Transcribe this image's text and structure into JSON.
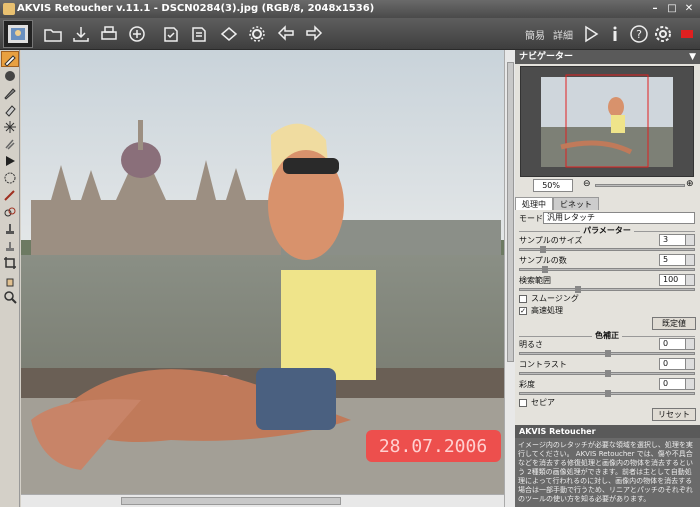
{
  "window": {
    "title": "AKVIS Retoucher v.11.1 - DSCN0284(3).jpg (RGB/8, 2048x1536)",
    "controls": [
      "minimize",
      "maximize",
      "close"
    ]
  },
  "toolbar": {
    "mode_simple": "簡易",
    "mode_detail": "詳細",
    "icons": [
      "open-icon",
      "save-icon",
      "print-icon",
      "share-icon",
      "batch-icon",
      "import-icon",
      "plugin-icon",
      "settings-gear-icon",
      "undo-arrow-icon",
      "redo-arrow-icon",
      "run-icon",
      "info-icon",
      "help-icon",
      "preferences-icon",
      "notify-icon"
    ]
  },
  "tools": [
    "retouch",
    "fill",
    "brush",
    "eraser",
    "magic",
    "clone",
    "run",
    "patch",
    "chameleon",
    "smart-tool",
    "stamp",
    "crop",
    "hand",
    "zoom"
  ],
  "navigator": {
    "title": "ナビゲーター",
    "zoom": "50%"
  },
  "tabs": {
    "active": "処理中",
    "other": "ビネット"
  },
  "processing": {
    "mode_label": "モード",
    "mode_value": "汎用レタッチ",
    "params_section": "パラメーター",
    "sample_size_label": "サンプルのサイズ",
    "sample_size_value": "3",
    "sample_count_label": "サンプルの数",
    "sample_count_value": "5",
    "search_range_label": "検索範囲",
    "search_range_value": "100",
    "smoothing_label": "スムージング",
    "smoothing_checked": false,
    "fast_label": "高速処理",
    "fast_checked": true,
    "default_button": "既定値",
    "color_section": "色補正",
    "brightness_label": "明るさ",
    "brightness_value": "0",
    "contrast_label": "コントラスト",
    "contrast_value": "0",
    "saturation_label": "彩度",
    "saturation_value": "0",
    "sepia_label": "セピア",
    "sepia_checked": false,
    "reset_button": "リセット"
  },
  "help": {
    "title": "AKVIS Retoucher",
    "text": "イメージ内のレタッチが必要な領域を選択し、処理を実行してください。\nAKVIS Retoucher では、傷や不具合などを消去する修復処理と画像内の物体を消去するという 2種類の画像処理ができます。前者は主として自動処理によって行われるのに対し、画像内の物体を消去する場合は一部手動で行うため、リニアとパッチのそれぞれのツールの使い方を知る必要があります。"
  },
  "photo": {
    "date_stamp": "28.07.2006"
  },
  "colors": {
    "active_tool": "#e8a040",
    "date_stamp": "#ff3b3b",
    "toolbar_bg": "#4a4a4a"
  }
}
